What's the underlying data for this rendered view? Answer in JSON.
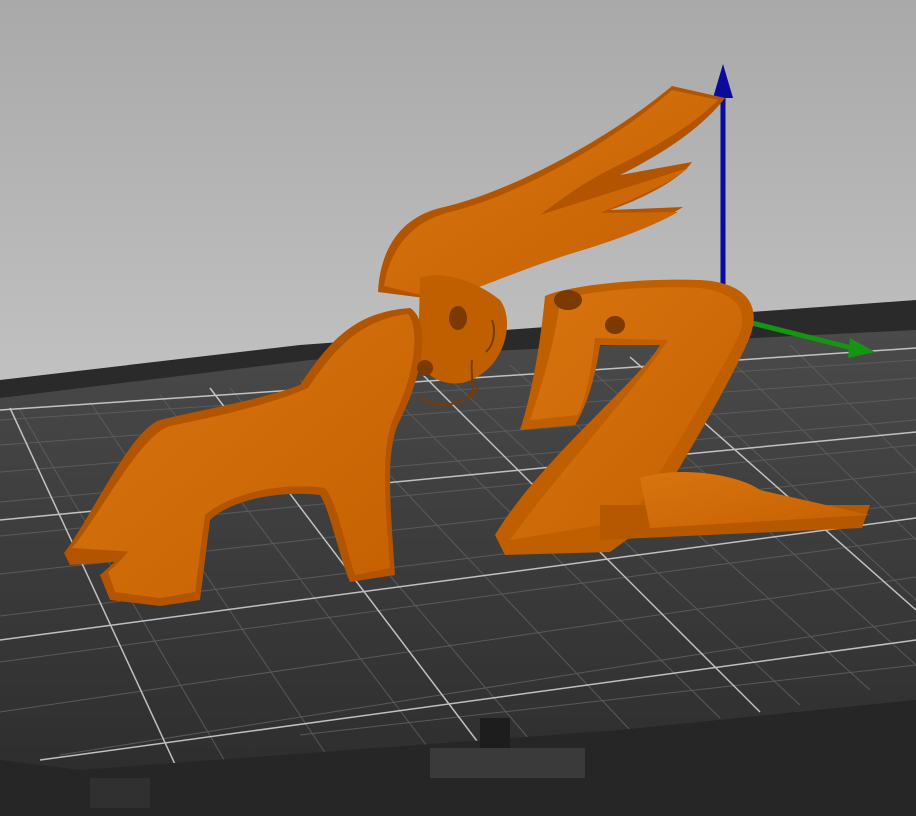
{
  "viewer": {
    "scene": "3d-print-preview",
    "object_color": "#c86400",
    "bed_color": "#3a3a3a",
    "axis_colors": {
      "z": "#0a0a9c",
      "y": "#149614"
    }
  }
}
